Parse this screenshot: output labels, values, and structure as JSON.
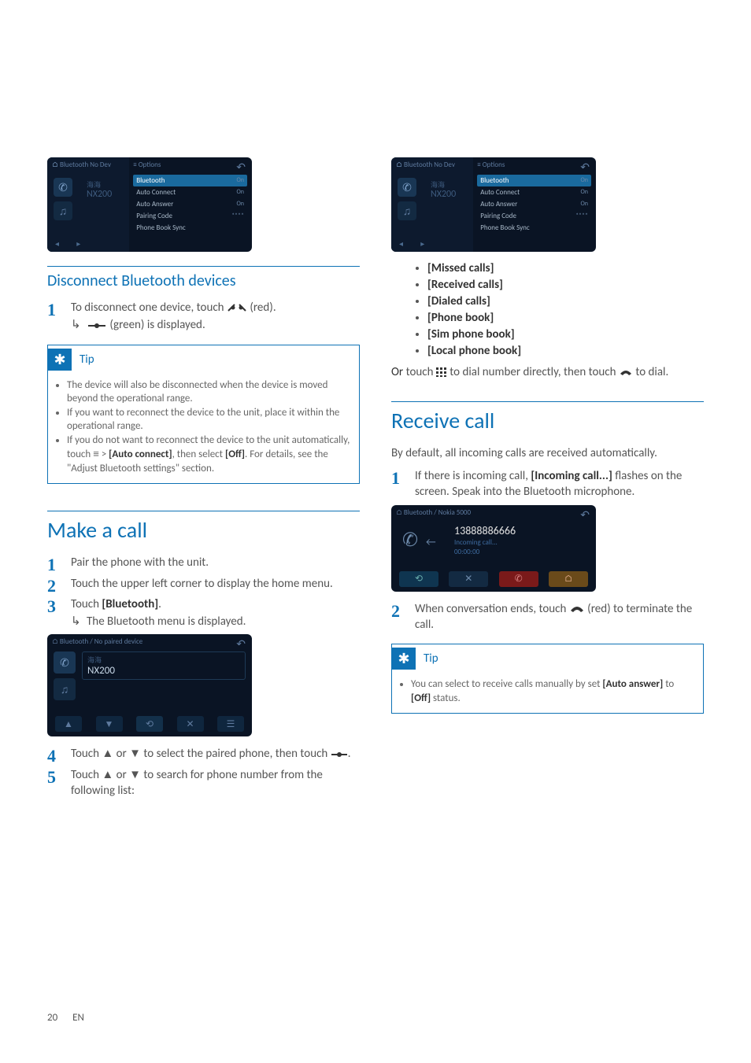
{
  "figA": {
    "breadcrumb_home": "⌂",
    "breadcrumb_bt": "Bluetooth",
    "breadcrumb_nd": "No Dev",
    "nx_label": "海海",
    "nx": "NX200",
    "opt_header": "≡ Options",
    "back": "↶",
    "rows": [
      {
        "k": "Bluetooth",
        "v": "On"
      },
      {
        "k": "Auto Connect",
        "v": "On"
      },
      {
        "k": "Auto Answer",
        "v": "On"
      },
      {
        "k": "Pairing Code",
        "v": "****"
      },
      {
        "k": "Phone Book Sync",
        "v": ""
      }
    ],
    "phone_icon": "✆",
    "music_icon": "♫",
    "nav": "◂ ▸"
  },
  "disconnect": {
    "heading": "Disconnect Bluetooth devices",
    "step1_a": "To disconnect one device, touch ",
    "step1_b": " (red).",
    "step1_sub_a": " (green) is displayed.",
    "tip_label": "Tip",
    "tips": [
      "The device will also be disconnected when the device is moved beyond the operational range.",
      "If you want to reconnect the device to the unit, place it within the operational range.",
      "If you do not want to reconnect the device to the unit automatically, touch ≡ > [Auto connect], then select [Off]. For details, see the \"Adjust Bluetooth settings\" section."
    ],
    "tip3_a": "If you do not want to reconnect the device to the unit automatically, touch ",
    "tip3_b": " > ",
    "tip3_c": ", then select ",
    "tip3_d": ". For details, see the \"Adjust Bluetooth settings\" section.",
    "tip3_bold1": "[Auto connect]",
    "tip3_bold2": "[Off]"
  },
  "make_call": {
    "heading": "Make a call",
    "step1": "Pair the phone with the unit.",
    "step2": "Touch the upper left corner to display the home menu.",
    "step3_a": "Touch ",
    "step3_b": ".",
    "step3_bold": "[Bluetooth]",
    "step3_sub": "The Bluetooth menu is displayed.",
    "step4_a": "Touch ",
    "step4_b": " or ",
    "step4_c": " to select the paired phone, then touch ",
    "step4_d": ".",
    "step5_a": "Touch ",
    "step5_b": " or ",
    "step5_c": " to search for phone number from the following list:"
  },
  "figB": {
    "breadcrumb": "⌂ Bluetooth  /  No paired device",
    "back": "↶",
    "nx_label": "海海",
    "nx": "NX200",
    "phone_icon": "✆",
    "music_icon": "♫",
    "btns": [
      "▲",
      "▼",
      "⟲",
      "✕",
      "☰"
    ]
  },
  "call_types": {
    "items": [
      "[Missed calls]",
      "[Received calls]",
      "[Dialed calls]",
      "[Phone book]",
      "[Sim phone book]",
      "[Local phone book]"
    ],
    "or_a": "Or",
    "or_b": " touch ",
    "or_c": " to dial number directly, then touch ",
    "or_d": " to dial."
  },
  "receive": {
    "heading": "Receive call",
    "intro": "By default, all incoming calls are received automatically.",
    "step1_a": "If there is incoming call, ",
    "step1_bold": "[Incoming call...]",
    "step1_b": " flashes on the screen. Speak into the Bluetooth microphone.",
    "step2_a": "When conversation ends, touch ",
    "step2_b": " (red) to terminate the call.",
    "tip_label": "Tip",
    "tip_a": "You can select to receive calls manually by set ",
    "tip_bold1": "[Auto answer]",
    "tip_b": " to ",
    "tip_bold2": "[Off]",
    "tip_c": " status."
  },
  "figC": {
    "breadcrumb": "⌂ Bluetooth  /  Nokia 5000",
    "back": "↶",
    "phone_icon": "✆",
    "arrow": "←",
    "number": "13888886666",
    "incoming": "Incoming call...",
    "time": "00:00:00",
    "btns": [
      "⟲",
      "✕",
      "✆",
      "⌂"
    ]
  },
  "icons": {
    "red_disc": "⟿",
    "green_link": "⟿",
    "up": "▲",
    "down": "▼",
    "link": "⟲",
    "menu": "≡",
    "grid": "⁞⁞⁞",
    "hangup": "✆"
  },
  "footer": {
    "page": "20",
    "lang": "EN"
  }
}
